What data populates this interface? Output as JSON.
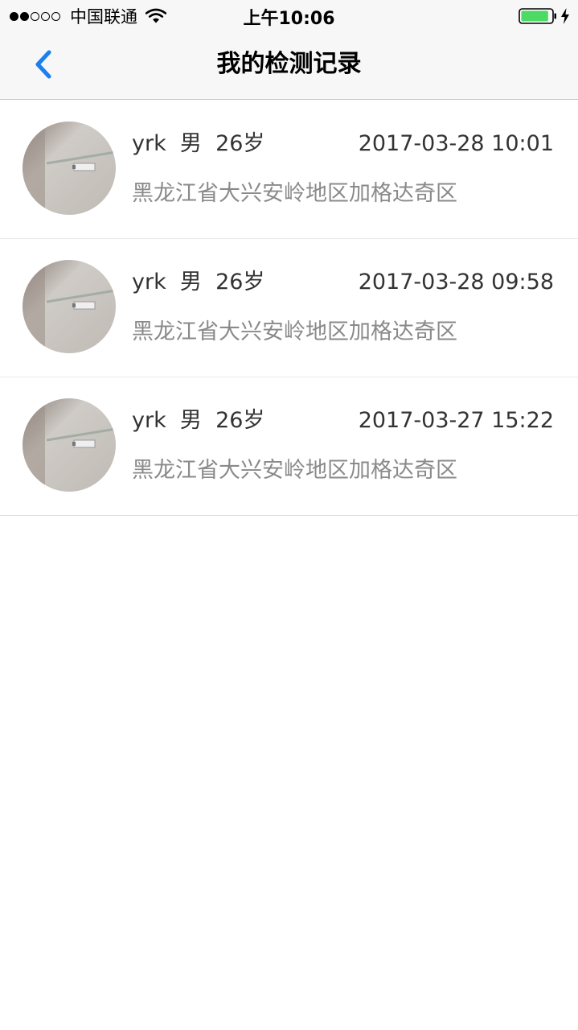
{
  "status_bar": {
    "carrier": "中国联通",
    "time": "上午10:06",
    "signal_strength": 2,
    "signal_max": 5,
    "battery_level": 0.9,
    "battery_color": "#4cd964",
    "charging": true
  },
  "nav": {
    "title": "我的检测记录",
    "back_icon": "chevron-left-icon",
    "accent_color": "#1a7ff0"
  },
  "records": [
    {
      "name": "yrk",
      "gender": "男",
      "age": "26岁",
      "time": "2017-03-28 10:01",
      "address": "黑龙江省大兴安岭地区加格达奇区"
    },
    {
      "name": "yrk",
      "gender": "男",
      "age": "26岁",
      "time": "2017-03-28 09:58",
      "address": "黑龙江省大兴安岭地区加格达奇区"
    },
    {
      "name": "yrk",
      "gender": "男",
      "age": "26岁",
      "time": "2017-03-27 15:22",
      "address": "黑龙江省大兴安岭地区加格达奇区"
    }
  ]
}
